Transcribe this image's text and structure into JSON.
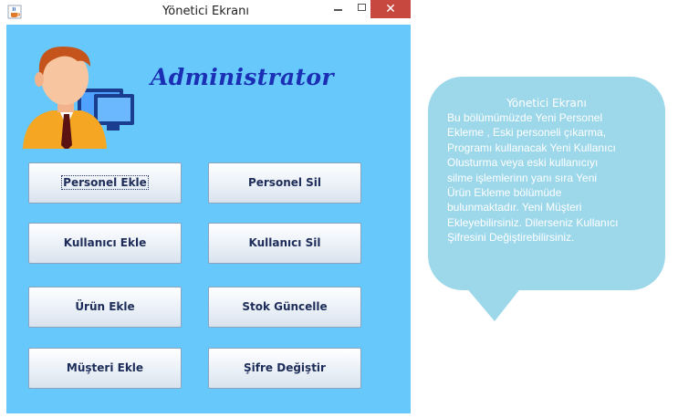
{
  "window": {
    "title": "Yönetici Ekranı",
    "minimize_symbol": "",
    "maximize_symbol": "",
    "close_symbol": "✕"
  },
  "header": {
    "brand": "Administrator"
  },
  "buttons": {
    "personel_ekle": "Personel Ekle",
    "personel_sil": "Personel Sil",
    "kullanici_ekle": "Kullanıcı Ekle",
    "kullanici_sil": "Kullanıcı Sil",
    "urun_ekle": "Ürün Ekle",
    "stok_guncelle": "Stok Güncelle",
    "musteri_ekle": "Müşteri Ekle",
    "sifre_degistir": "Şifre Değiştir"
  },
  "bubble": {
    "title": "Yönetici Ekranı",
    "body": "Bu bölümümüzde Yeni Personel\nEkleme , Eski personeli çıkarma,\nProgramı kullanacak Yeni Kullanıcı\nOlusturma veya eski kullanıcıyı\nsilme işlemlerinn yanı sıra Yeni\nÜrün Ekleme bölümüde\nbulunmaktadır. Yeni Müşteri\nEkleyebilirsiniz. Dilerseniz Kullanıcı\nŞifresini Değiştirebilirsiniz."
  },
  "colors": {
    "panel_background": "#66c8fb",
    "brand_text": "#1b2fb5",
    "bubble_fill": "#9dd8ea",
    "close_button": "#c7483f"
  },
  "icons": {
    "app": "java-coffee-icon",
    "avatar": "admin-user-computer-icon"
  }
}
